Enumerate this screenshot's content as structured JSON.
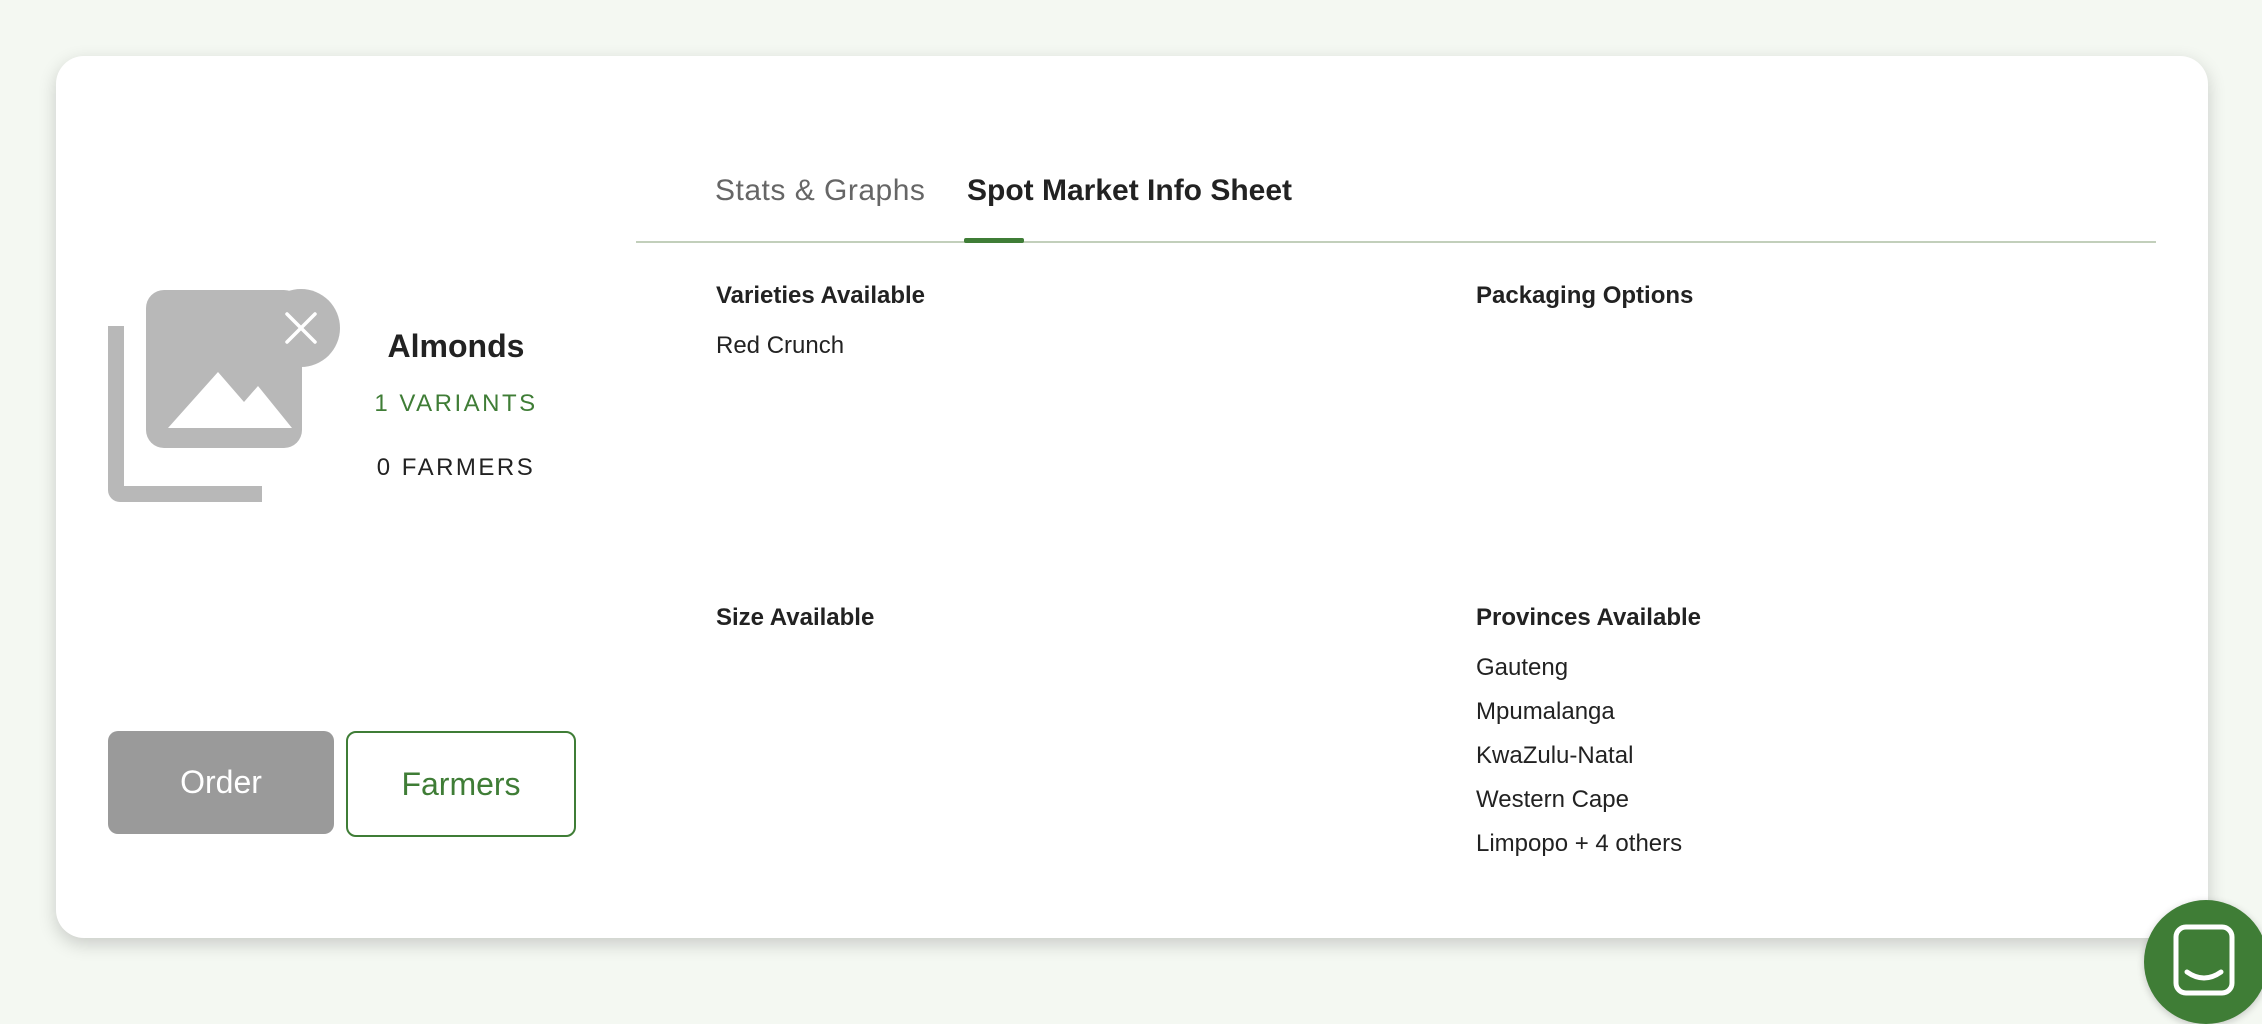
{
  "tabs": [
    {
      "label": "Stats & Graphs",
      "active": false
    },
    {
      "label": "Spot Market Info Sheet",
      "active": true
    }
  ],
  "product": {
    "name": "Almonds",
    "variants_label": "1 VARIANTS",
    "farmers_label": "0 FARMERS",
    "image_icon": "image-placeholder-icon",
    "remove_icon": "close-icon"
  },
  "actions": {
    "order_label": "Order",
    "farmers_label": "Farmers"
  },
  "info": {
    "varieties": {
      "title": "Varieties Available",
      "items": [
        "Red Crunch"
      ]
    },
    "packaging": {
      "title": "Packaging Options",
      "items": []
    },
    "size": {
      "title": "Size Available",
      "items": []
    },
    "provinces": {
      "title": "Provinces Available",
      "items": [
        "Gauteng",
        "Mpumalanga",
        "KwaZulu-Natal",
        "Western Cape",
        "Limpopo + 4 others"
      ]
    }
  },
  "chat": {
    "icon": "chat-icon"
  },
  "colors": {
    "accent": "#3f7d36",
    "page_background": "#f4f8f2",
    "disabled_button": "#9a9a9a",
    "placeholder_gray": "#b8b8b8"
  }
}
